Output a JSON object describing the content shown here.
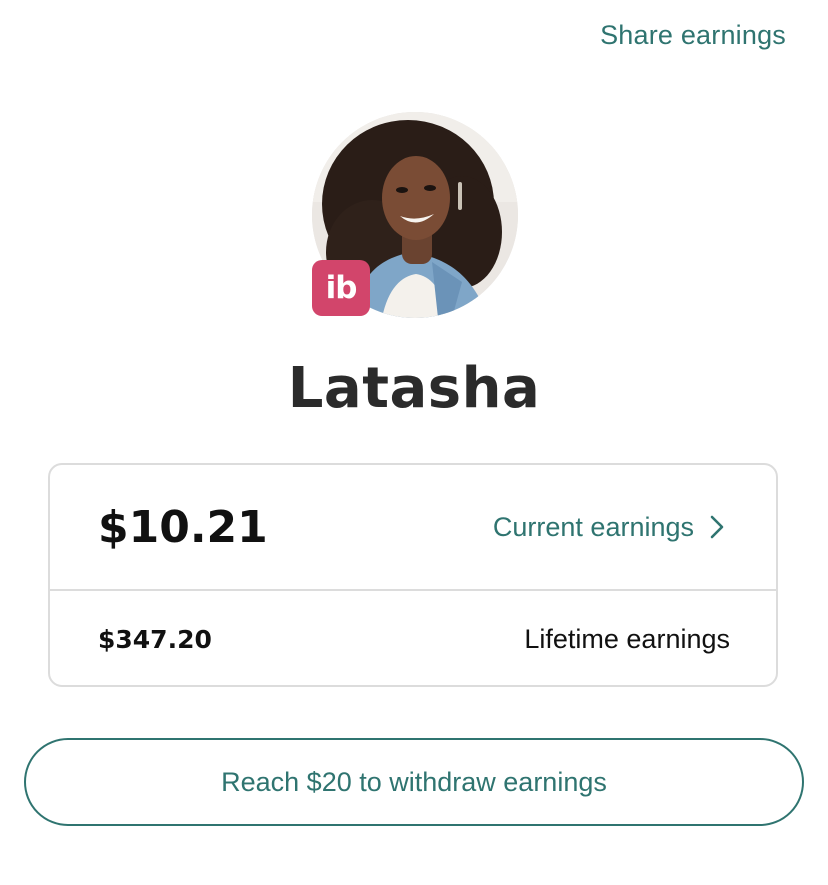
{
  "colors": {
    "accent": "#2f7470",
    "badge": "#d2456b"
  },
  "header": {
    "share_label": "Share earnings"
  },
  "profile": {
    "avatar_icon": "profile-photo",
    "badge_text": "ib",
    "name": "Latasha"
  },
  "earnings": {
    "current_amount": "$10.21",
    "current_label": "Current earnings",
    "current_chevron_icon": "chevron-right-icon",
    "lifetime_amount": "$347.20",
    "lifetime_label": "Lifetime earnings"
  },
  "withdraw": {
    "button_label": "Reach $20 to withdraw earnings"
  }
}
